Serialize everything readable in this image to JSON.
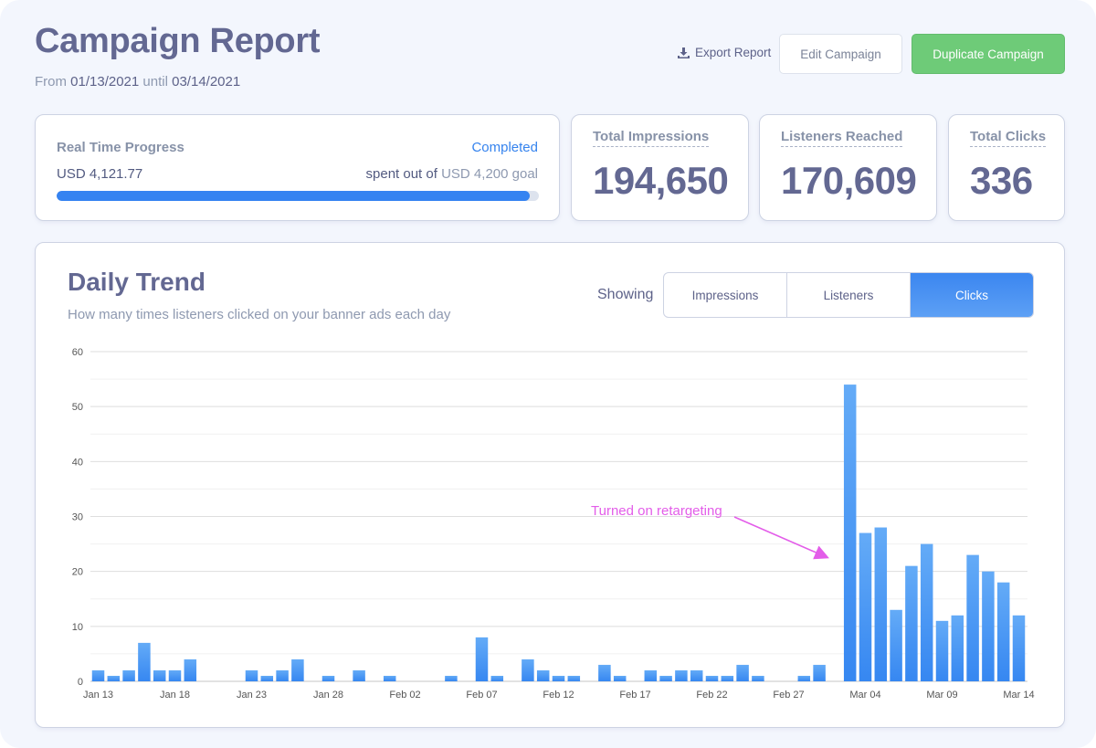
{
  "header": {
    "title": "Campaign Report",
    "date_prefix": "From",
    "start_date": "01/13/2021",
    "date_mid": "until",
    "end_date": "03/14/2021",
    "export_label": "Export Report",
    "edit_label": "Edit Campaign",
    "duplicate_label": "Duplicate Campaign"
  },
  "progress": {
    "label": "Real Time Progress",
    "status": "Completed",
    "spent": "USD 4,121.77",
    "goal_prefix": "spent out of",
    "goal": "USD 4,200",
    "goal_suffix": "goal",
    "fraction": 0.9814
  },
  "stats": [
    {
      "label": "Total Impressions",
      "value": "194,650"
    },
    {
      "label": "Listeners Reached",
      "value": "170,609"
    },
    {
      "label": "Total Clicks",
      "value": "336"
    }
  ],
  "trend": {
    "title": "Daily Trend",
    "subtitle": "How many times listeners clicked on your banner ads each day",
    "showing_label": "Showing",
    "tabs": [
      "Impressions",
      "Listeners",
      "Clicks"
    ],
    "active_tab": "Clicks"
  },
  "colors": {
    "bar": "#3d8bf2",
    "annotation": "#e35de9",
    "primary": "#3583f1",
    "success": "#6ecb78"
  },
  "chart_data": {
    "type": "bar",
    "title": "Daily Trend",
    "xlabel": "",
    "ylabel": "",
    "ylim": [
      0,
      60
    ],
    "yticks": [
      0,
      10,
      20,
      30,
      40,
      50,
      60
    ],
    "grid": true,
    "x_tick_labels": [
      "Jan 13",
      "Jan 18",
      "Jan 23",
      "Jan 28",
      "Feb 02",
      "Feb 07",
      "Feb 12",
      "Feb 17",
      "Feb 22",
      "Feb 27",
      "Mar 04",
      "Mar 09",
      "Mar 14"
    ],
    "categories": [
      "Jan 13",
      "Jan 14",
      "Jan 15",
      "Jan 16",
      "Jan 17",
      "Jan 18",
      "Jan 19",
      "Jan 20",
      "Jan 21",
      "Jan 22",
      "Jan 23",
      "Jan 24",
      "Jan 25",
      "Jan 26",
      "Jan 27",
      "Jan 28",
      "Jan 29",
      "Jan 30",
      "Jan 31",
      "Feb 01",
      "Feb 02",
      "Feb 03",
      "Feb 04",
      "Feb 05",
      "Feb 06",
      "Feb 07",
      "Feb 08",
      "Feb 09",
      "Feb 10",
      "Feb 11",
      "Feb 12",
      "Feb 13",
      "Feb 14",
      "Feb 15",
      "Feb 16",
      "Feb 17",
      "Feb 18",
      "Feb 19",
      "Feb 20",
      "Feb 21",
      "Feb 22",
      "Feb 23",
      "Feb 24",
      "Feb 25",
      "Feb 26",
      "Feb 27",
      "Feb 28",
      "Mar 01",
      "Mar 02",
      "Mar 03",
      "Mar 04",
      "Mar 05",
      "Mar 06",
      "Mar 07",
      "Mar 08",
      "Mar 09",
      "Mar 10",
      "Mar 11",
      "Mar 12",
      "Mar 13",
      "Mar 14"
    ],
    "values": [
      2,
      1,
      2,
      7,
      2,
      2,
      4,
      0,
      0,
      0,
      2,
      1,
      2,
      4,
      0,
      1,
      0,
      2,
      0,
      1,
      0,
      0,
      0,
      1,
      0,
      8,
      1,
      0,
      4,
      2,
      1,
      1,
      0,
      3,
      1,
      0,
      2,
      1,
      2,
      2,
      1,
      1,
      3,
      1,
      0,
      0,
      1,
      3,
      0,
      54,
      27,
      28,
      13,
      21,
      25,
      11,
      12,
      23,
      20,
      18,
      12
    ],
    "annotations": [
      {
        "text": "Turned on retargeting",
        "points_to": "Mar 03"
      }
    ]
  }
}
